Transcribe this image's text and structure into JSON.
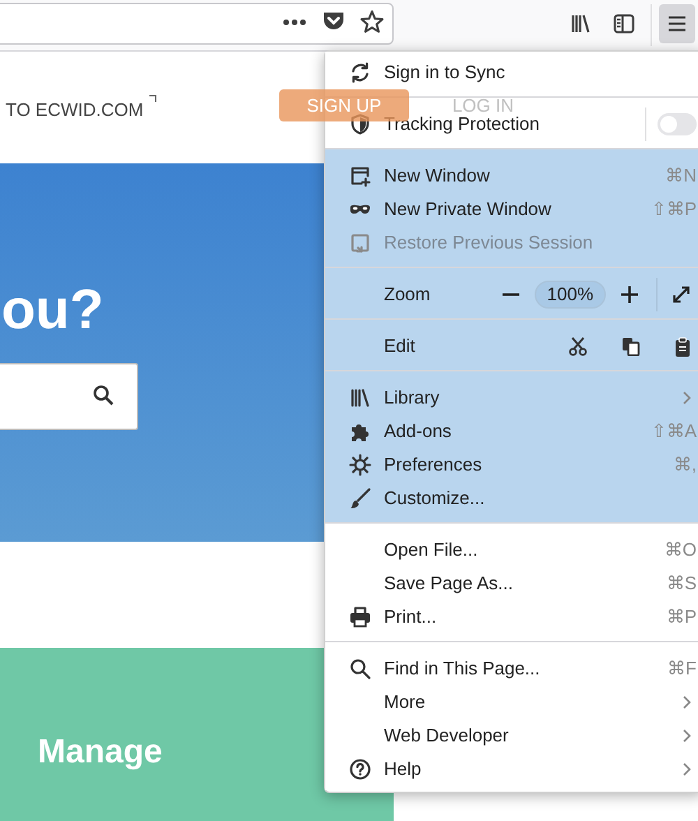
{
  "page": {
    "header_link": "TO ECWID.COM",
    "sign_up": "SIGN UP",
    "log_in": "LOG IN",
    "hero_title": "ou?",
    "banner_title": "Manage"
  },
  "menu": {
    "sections": [
      {
        "highlighted": false,
        "items": [
          {
            "kind": "item",
            "label": "Sign in to Sync",
            "disabled": false,
            "submenu": false
          }
        ]
      },
      {
        "highlighted": false,
        "items": [
          {
            "kind": "toggle",
            "label": "Tracking Protection",
            "on": false
          }
        ]
      },
      {
        "highlighted": true,
        "items": [
          {
            "kind": "item",
            "label": "New Window",
            "shortcut": "⌘N",
            "disabled": false,
            "submenu": false
          },
          {
            "kind": "item",
            "label": "New Private Window",
            "shortcut": "⇧⌘P",
            "disabled": false,
            "submenu": false
          },
          {
            "kind": "item",
            "label": "Restore Previous Session",
            "disabled": true,
            "submenu": false
          }
        ]
      },
      {
        "highlighted": true,
        "items": [
          {
            "kind": "zoom",
            "label": "Zoom",
            "value": "100%"
          }
        ]
      },
      {
        "highlighted": true,
        "items": [
          {
            "kind": "edit",
            "label": "Edit"
          }
        ]
      },
      {
        "highlighted": true,
        "items": [
          {
            "kind": "item",
            "label": "Library",
            "disabled": false,
            "submenu": true
          },
          {
            "kind": "item",
            "label": "Add-ons",
            "shortcut": "⇧⌘A",
            "disabled": false,
            "submenu": false
          },
          {
            "kind": "item",
            "label": "Preferences",
            "shortcut": "⌘,",
            "disabled": false,
            "submenu": false
          },
          {
            "kind": "item",
            "label": "Customize...",
            "disabled": false,
            "submenu": false
          }
        ]
      },
      {
        "highlighted": false,
        "items": [
          {
            "kind": "item",
            "label": "Open File...",
            "shortcut": "⌘O",
            "disabled": false,
            "submenu": false
          },
          {
            "kind": "item",
            "label": "Save Page As...",
            "shortcut": "⌘S",
            "disabled": false,
            "submenu": false
          },
          {
            "kind": "item",
            "label": "Print...",
            "shortcut": "⌘P",
            "disabled": false,
            "submenu": false
          }
        ]
      },
      {
        "highlighted": false,
        "items": [
          {
            "kind": "item",
            "label": "Find in This Page...",
            "shortcut": "⌘F",
            "disabled": false,
            "submenu": false
          },
          {
            "kind": "item",
            "label": "More",
            "disabled": false,
            "submenu": true
          },
          {
            "kind": "item",
            "label": "Web Developer",
            "disabled": false,
            "submenu": true
          },
          {
            "kind": "item",
            "label": "Help",
            "disabled": false,
            "submenu": true
          }
        ]
      }
    ]
  }
}
